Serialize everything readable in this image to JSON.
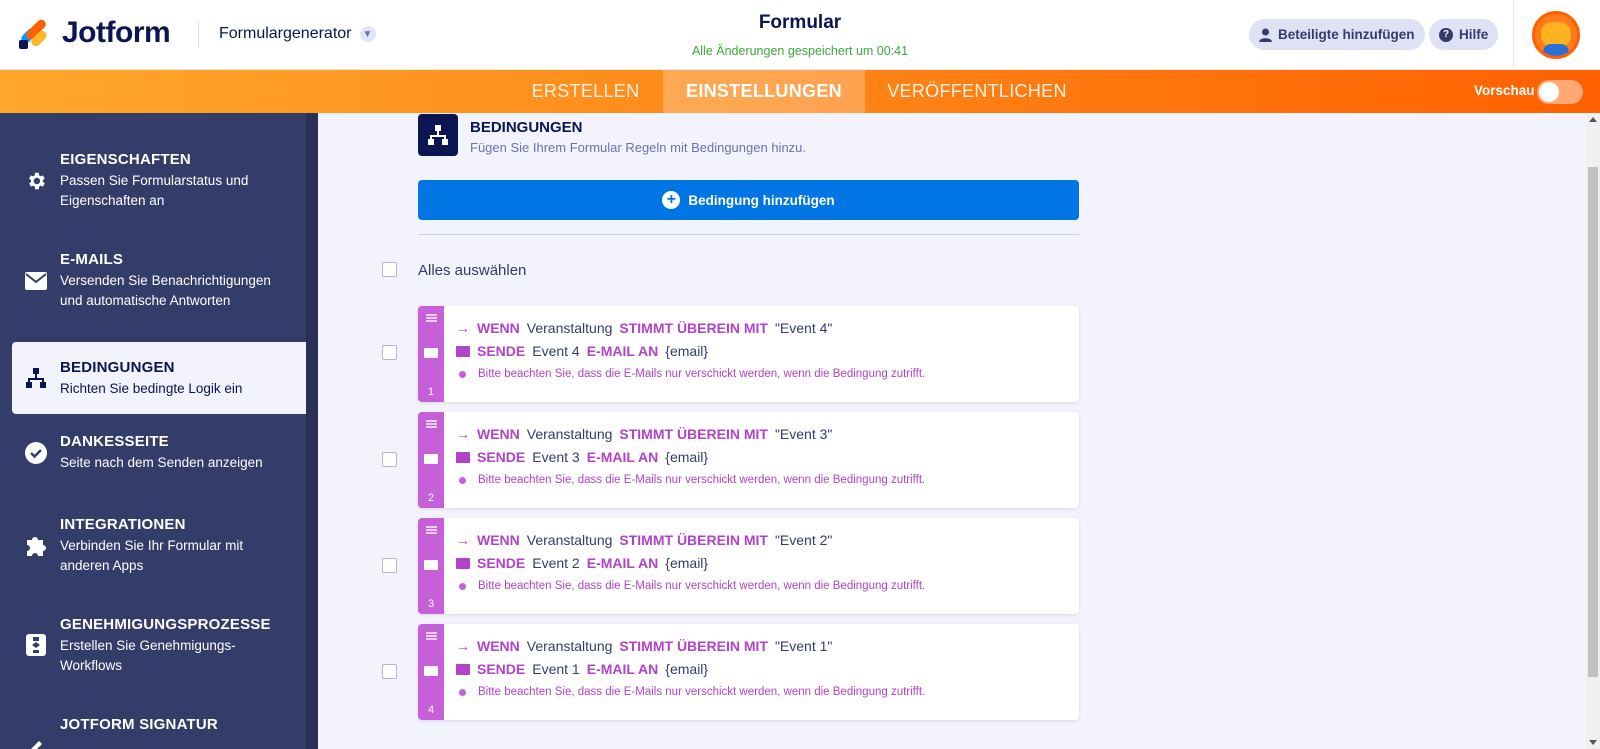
{
  "header": {
    "logo_text": "Jotform",
    "form_builder_label": "Formulargenerator",
    "form_title": "Formular",
    "saved_status": "Alle Änderungen gespeichert um 00:41",
    "add_participants_label": "Beteiligte hinzufügen",
    "help_label": "Hilfe"
  },
  "nav": {
    "tabs": [
      {
        "label": "ERSTELLEN"
      },
      {
        "label": "EINSTELLUNGEN"
      },
      {
        "label": "VERÖFFENTLICHEN"
      }
    ],
    "active_tab": "EINSTELLUNGEN",
    "preview_label": "Vorschau",
    "preview_on": false
  },
  "sidebar": {
    "items": [
      {
        "title": "EIGENSCHAFTEN",
        "desc": "Passen Sie Formularstatus und Eigenschaften an",
        "icon": "gear-icon"
      },
      {
        "title": "E-MAILS",
        "desc": "Versenden Sie Benachrichtigungen und automatische Antworten",
        "icon": "envelope-icon"
      },
      {
        "title": "BEDINGUNGEN",
        "desc": "Richten Sie bedingte Logik ein",
        "icon": "hierarchy-icon"
      },
      {
        "title": "DANKESSEITE",
        "desc": "Seite nach dem Senden anzeigen",
        "icon": "check-circle-icon"
      },
      {
        "title": "INTEGRATIONEN",
        "desc": "Verbinden Sie Ihr Formular mit anderen Apps",
        "icon": "puzzle-icon"
      },
      {
        "title": "GENEHMIGUNGSPROZESSE",
        "desc": "Erstellen Sie Genehmigungs-Workflows",
        "icon": "workflow-icon"
      },
      {
        "title": "JOTFORM SIGNATUR",
        "desc": "",
        "icon": "signature-icon"
      }
    ],
    "active_item": "BEDINGUNGEN"
  },
  "main": {
    "section_title": "BEDINGUNGEN",
    "section_desc": "Fügen Sie Ihrem Formular Regeln mit Bedingungen hinzu.",
    "add_button_label": "Bedingung hinzufügen",
    "select_all_label": "Alles auswählen",
    "rules": [
      {
        "number": "1",
        "if_kw": "WENN",
        "field": "Veranstaltung",
        "op_kw": "STIMMT ÜBEREIN MIT",
        "value": "\"Event 4\"",
        "send_kw": "SENDE",
        "email_name": "Event 4",
        "to_kw": "E-MAIL AN",
        "recipient": "{email}",
        "note": "Bitte beachten Sie, dass die E-Mails nur verschickt werden, wenn die Bedingung zutrifft."
      },
      {
        "number": "2",
        "if_kw": "WENN",
        "field": "Veranstaltung",
        "op_kw": "STIMMT ÜBEREIN MIT",
        "value": "\"Event 3\"",
        "send_kw": "SENDE",
        "email_name": "Event 3",
        "to_kw": "E-MAIL AN",
        "recipient": "{email}",
        "note": "Bitte beachten Sie, dass die E-Mails nur verschickt werden, wenn die Bedingung zutrifft."
      },
      {
        "number": "3",
        "if_kw": "WENN",
        "field": "Veranstaltung",
        "op_kw": "STIMMT ÜBEREIN MIT",
        "value": "\"Event 2\"",
        "send_kw": "SENDE",
        "email_name": "Event 2",
        "to_kw": "E-MAIL AN",
        "recipient": "{email}",
        "note": "Bitte beachten Sie, dass die E-Mails nur verschickt werden, wenn die Bedingung zutrifft."
      },
      {
        "number": "4",
        "if_kw": "WENN",
        "field": "Veranstaltung",
        "op_kw": "STIMMT ÜBEREIN MIT",
        "value": "\"Event 1\"",
        "send_kw": "SENDE",
        "email_name": "Event 1",
        "to_kw": "E-MAIL AN",
        "recipient": "{email}",
        "note": "Bitte beachten Sie, dass die E-Mails nur verschickt werden, wenn die Bedingung zutrifft."
      }
    ]
  },
  "colors": {
    "brand_navy": "#0a1551",
    "orange": "#ff6100",
    "blue_button": "#0075e3",
    "condition_purple": "#b143c9",
    "saved_green": "#3aa93a"
  }
}
